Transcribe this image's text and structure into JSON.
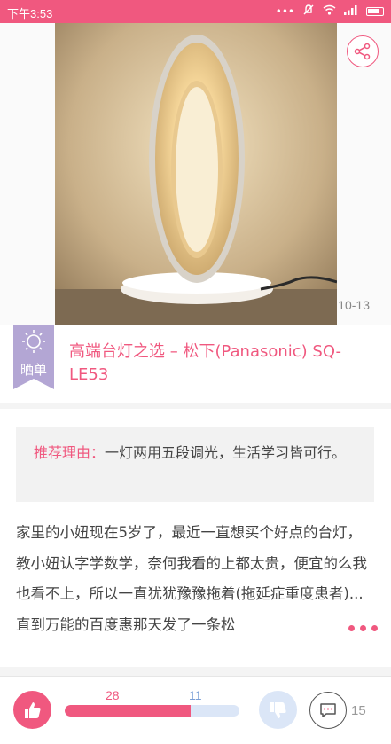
{
  "status_bar": {
    "time": "下午3:53",
    "background": "#f0587f"
  },
  "hero": {
    "date": "10-13",
    "image": "table-lamp-photo"
  },
  "tag": {
    "label": "晒单",
    "icon": "sun-icon"
  },
  "post": {
    "title": "高端台灯之选 – 松下(Panasonic) SQ-LE53"
  },
  "reason": {
    "label": "推荐理由：",
    "text": "一灯两用五段调光，生活学习皆可行。"
  },
  "body": {
    "text": "家里的小妞现在5岁了，最近一直想买个好点的台灯，教小妞认字学数学，奈何我看的上都太贵，便宜的么我也看不上，所以一直犹犹豫豫拖着(拖延症重度患者)...直到万能的百度惠那天发了一条松"
  },
  "votes": {
    "likes": "28",
    "dislikes": "11",
    "like_fraction": 0.72
  },
  "comments": {
    "count": "15"
  },
  "colors": {
    "accent": "#f0587f",
    "dislike": "#dbe6f7",
    "tag": "#b3a6d4"
  }
}
